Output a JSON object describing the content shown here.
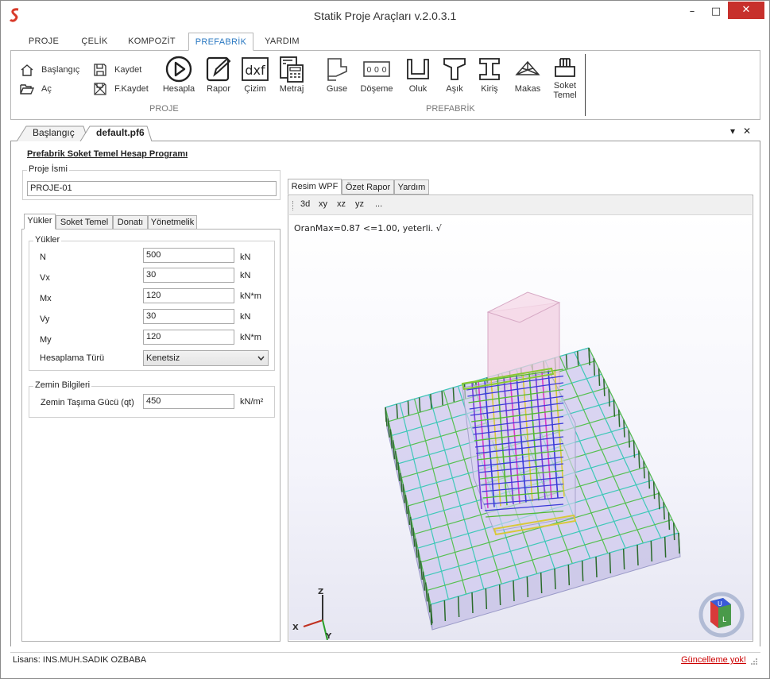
{
  "window": {
    "title": "Statik Proje Araçları v.2.0.3.1",
    "min": "–",
    "max": "□",
    "close": "✕"
  },
  "ribbon": {
    "tabs": [
      "PROJE",
      "ÇELİK",
      "KOMPOZİT",
      "PREFABRİK",
      "YARDIM"
    ],
    "active_tab": "PREFABRİK",
    "proje_small": [
      "Başlangıç",
      "Aç",
      "Kaydet",
      "F.Kaydet"
    ],
    "proje_big": [
      "Hesapla",
      "Rapor",
      "Çizim",
      "Metraj"
    ],
    "prefab_big": [
      "Guse",
      "Döşeme",
      "Oluk",
      "Aşık",
      "Kiriş",
      "Makas",
      "Soket Temel"
    ],
    "group_proje": "PROJE",
    "group_prefabrik": "PREFABRİK",
    "dxf_text": "dxf",
    "doseme_text": "0 0 0"
  },
  "doc_tabs": [
    "Başlangıç",
    "default.pf6"
  ],
  "doc_tab_controls": {
    "dropdown": "▾",
    "close": "✕"
  },
  "form": {
    "program_title": "Prefabrik Soket Temel Hesap Programı",
    "proje_ismi_label": "Proje İsmi",
    "proje_ismi_value": "PROJE-01",
    "tabs": [
      "Yükler",
      "Soket Temel",
      "Donatı",
      "Yönetmelik"
    ],
    "yukler_group": "Yükler",
    "loads": [
      {
        "label": "N",
        "value": "500",
        "unit": "kN"
      },
      {
        "label": "Vx",
        "value": "30",
        "unit": "kN"
      },
      {
        "label": "Mx",
        "value": "120",
        "unit": "kN*m"
      },
      {
        "label": "Vy",
        "value": "30",
        "unit": "kN"
      },
      {
        "label": "My",
        "value": "120",
        "unit": "kN*m"
      }
    ],
    "hesaplama_label": "Hesaplama Türü",
    "hesaplama_value": "Kenetsiz",
    "zemin_group": "Zemin Bilgileri",
    "zemin_label": "Zemin Taşıma Gücü (qt)",
    "zemin_value": "450",
    "zemin_unit": "kN/m²"
  },
  "viewer": {
    "tabs": [
      "Resim WPF",
      "Özet Rapor",
      "Yardım"
    ],
    "toolbar": [
      "3d",
      "xy",
      "xz",
      "yz",
      "..."
    ],
    "result_text": "OranMax=0.87 <=1.00, yeterli. √",
    "axis_labels": {
      "x": "X",
      "y": "Y",
      "z": "Z"
    },
    "cube_labels": {
      "front": "L",
      "top": "U"
    }
  },
  "status": {
    "license": "Lisans: INS.MUH.SADIK OZBABA",
    "update": "Güncelleme yok!"
  }
}
